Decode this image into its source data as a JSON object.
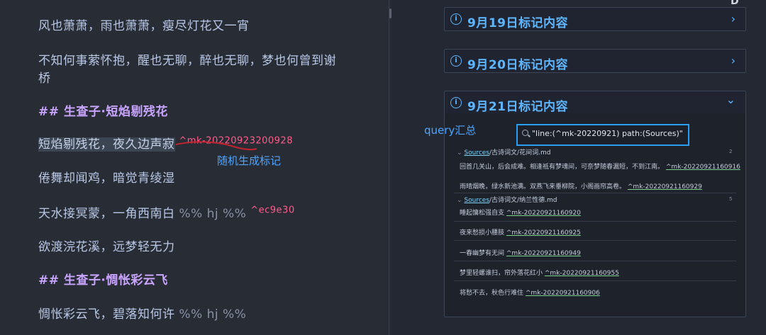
{
  "editor": {
    "lines": [
      "风也萧萧，雨也萧萧，瘦尽灯花又一宵",
      "不知何事萦怀抱，醒也无聊，醉也无聊，梦也何曾到谢",
      "桥",
      "## 生查子·短焰剔残花",
      "短焰剔残花，夜久边声寂",
      "^mk-20220923200928",
      "倦舞却闻鸡，暗觉青绫湿",
      "天水接冥蒙，一角西南白",
      "%% hj %%",
      "^ec9e30",
      "欲渡浣花溪，远梦轻无力",
      "## 生查子·惆怅彩云飞",
      "惆怅彩云飞，碧落知何许",
      "%% hj %%"
    ]
  },
  "annotations": {
    "random_mark": "随机生成标记",
    "query_summary": "query汇总"
  },
  "callouts": [
    {
      "title": "9月19日标记内容",
      "icon": "info-icon",
      "chevron": "›"
    },
    {
      "title": "9月20日标记内容",
      "icon": "info-icon",
      "chevron": "›"
    },
    {
      "title": "9月21日标记内容",
      "icon": "info-icon",
      "chevron": "⌄"
    }
  ],
  "query": {
    "text": "\"line:(^mk-20220921) path:(Sources)\""
  },
  "results": {
    "groups": [
      {
        "source": "Sources",
        "path": "/古诗词文/花间词.md",
        "count": "2",
        "rows": [
          {
            "text": "回首几关山，后会成难。相逢祗有梦魂间，可奈梦随春漏短，不到江南。",
            "tag": "^mk-20220921160916"
          },
          {
            "text": "雨晴烟晚，绿水新池满。双燕飞来垂柳院，小阁画帘高卷。",
            "tag": "^mk-20220921160929"
          }
        ]
      },
      {
        "source": "Sources",
        "path": "/古诗词文/纳兰性德.md",
        "count": "5",
        "rows": [
          {
            "text": "睡起慵松强自支",
            "tag": "^mk-20220921160920"
          },
          {
            "text": "夜来愁损小腰肢",
            "tag": "^mk-20220921160925"
          },
          {
            "text": "一春幽梦有无间",
            "tag": "^mk-20220921160949"
          },
          {
            "text": "梦里轻螺谁扫，帘外落花红小",
            "tag": "^mk-20220921160955"
          },
          {
            "text": "将愁不去，秋色行难住",
            "tag": "^mk-20220921160906"
          }
        ]
      }
    ]
  },
  "colors": {
    "accent": "#5fb6ff",
    "heading": "#c9a5ff",
    "mark_ref": "#ff5c8a",
    "annotation": "#4ea4ff",
    "query_border": "#2a9df4"
  }
}
